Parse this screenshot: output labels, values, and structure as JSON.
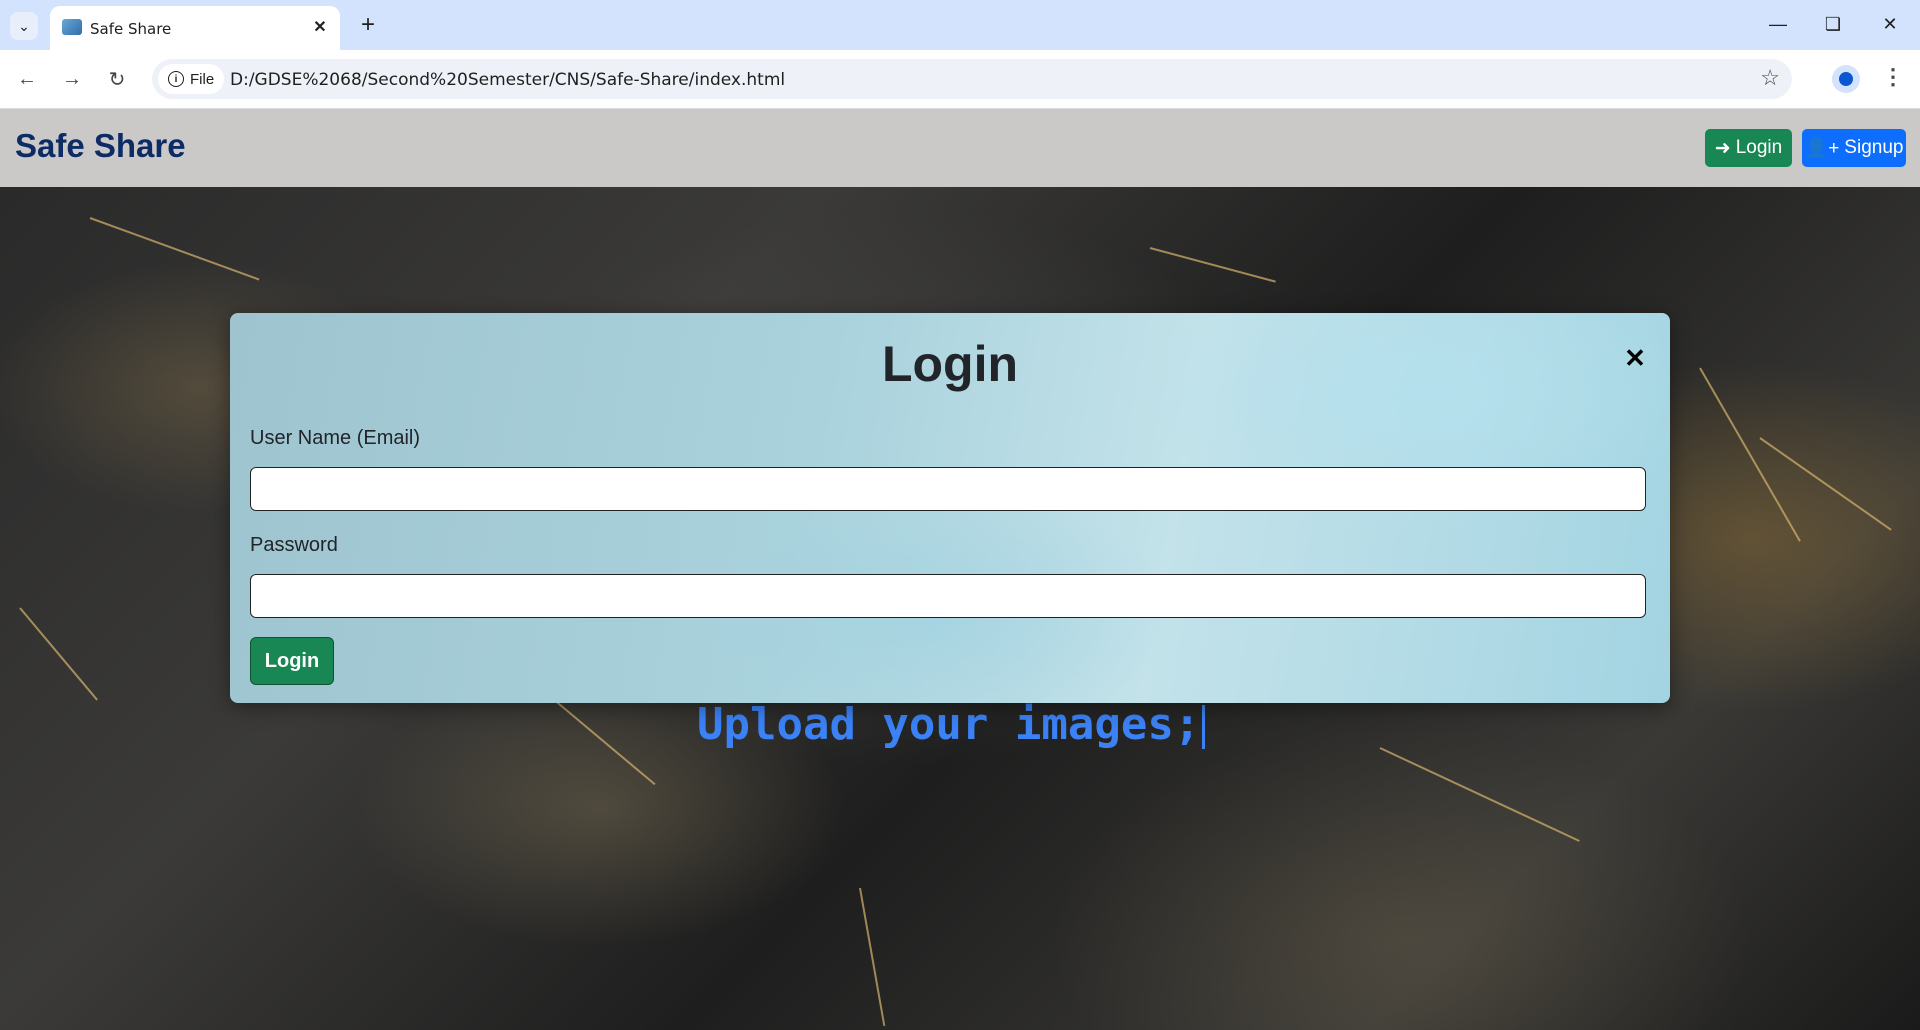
{
  "browser": {
    "tab_title": "Safe Share",
    "address_chip": "File",
    "url": "D:/GDSE%2068/Second%20Semester/CNS/Safe-Share/index.html"
  },
  "navbar": {
    "brand": "Safe Share",
    "login_label": "Login",
    "signup_label": "Signup"
  },
  "hero": {
    "typed_text": "Upload your images;"
  },
  "modal": {
    "title": "Login",
    "username_label": "User Name (Email)",
    "username_value": "",
    "password_label": "Password",
    "password_value": "",
    "submit_label": "Login"
  },
  "colors": {
    "login_green": "#198754",
    "signup_blue": "#0d6efd",
    "brand_navy": "#0d2c66",
    "typed_blue": "#3b82f6"
  },
  "icons": [
    "chevron-down-icon",
    "close-icon",
    "plus-icon",
    "back-arrow-icon",
    "forward-arrow-icon",
    "reload-icon",
    "info-icon",
    "star-icon",
    "profile-icon",
    "kebab-menu-icon",
    "login-icon",
    "user-plus-icon"
  ]
}
